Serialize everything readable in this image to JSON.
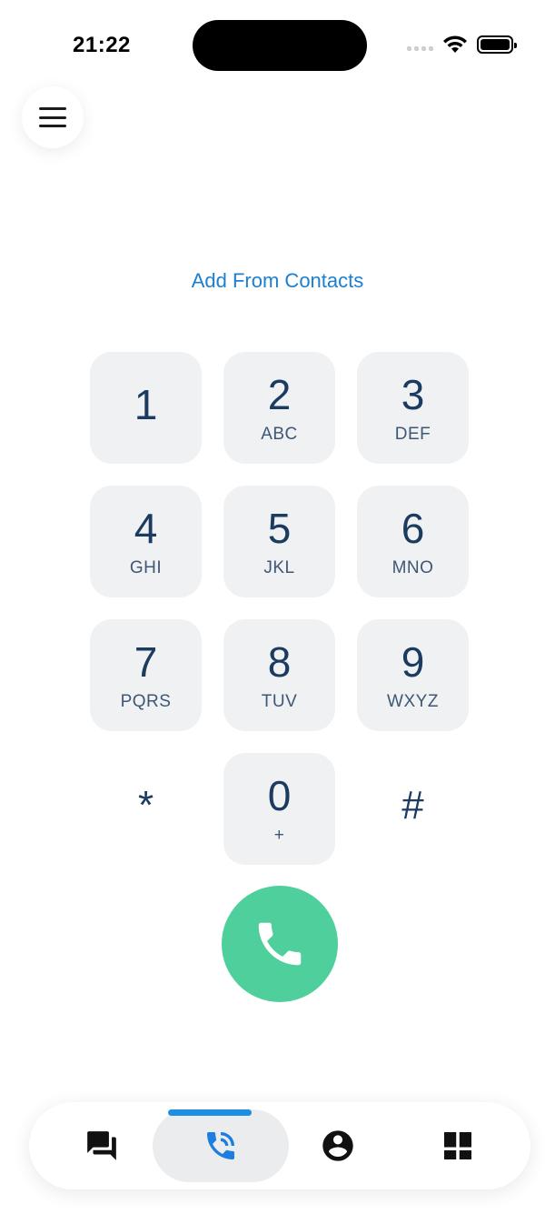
{
  "status_bar": {
    "time": "21:22",
    "icons": [
      "signal-icon",
      "wifi-icon",
      "battery-icon"
    ]
  },
  "menu": {
    "icon": "hamburger-menu-icon"
  },
  "add_contacts_label": "Add From Contacts",
  "keypad": {
    "keys": [
      {
        "digit": "1",
        "letters": ""
      },
      {
        "digit": "2",
        "letters": "ABC"
      },
      {
        "digit": "3",
        "letters": "DEF"
      },
      {
        "digit": "4",
        "letters": "GHI"
      },
      {
        "digit": "5",
        "letters": "JKL"
      },
      {
        "digit": "6",
        "letters": "MNO"
      },
      {
        "digit": "7",
        "letters": "PQRS"
      },
      {
        "digit": "8",
        "letters": "TUV"
      },
      {
        "digit": "9",
        "letters": "WXYZ"
      },
      {
        "digit": "*",
        "letters": ""
      },
      {
        "digit": "0",
        "letters": "+"
      },
      {
        "digit": "#",
        "letters": ""
      }
    ]
  },
  "call_button": {
    "icon": "phone-icon"
  },
  "bottom_nav": {
    "items": [
      {
        "icon": "chat-icon",
        "active": false
      },
      {
        "icon": "phone-call-icon",
        "active": true
      },
      {
        "icon": "account-icon",
        "active": false
      },
      {
        "icon": "dashboard-icon",
        "active": false
      }
    ]
  },
  "colors": {
    "accent": "#1c7fcf",
    "call_green": "#4fcf9b",
    "key_bg": "#eff1f3",
    "key_text": "#1b3b60",
    "nav_indicator": "#1c8fe3"
  }
}
